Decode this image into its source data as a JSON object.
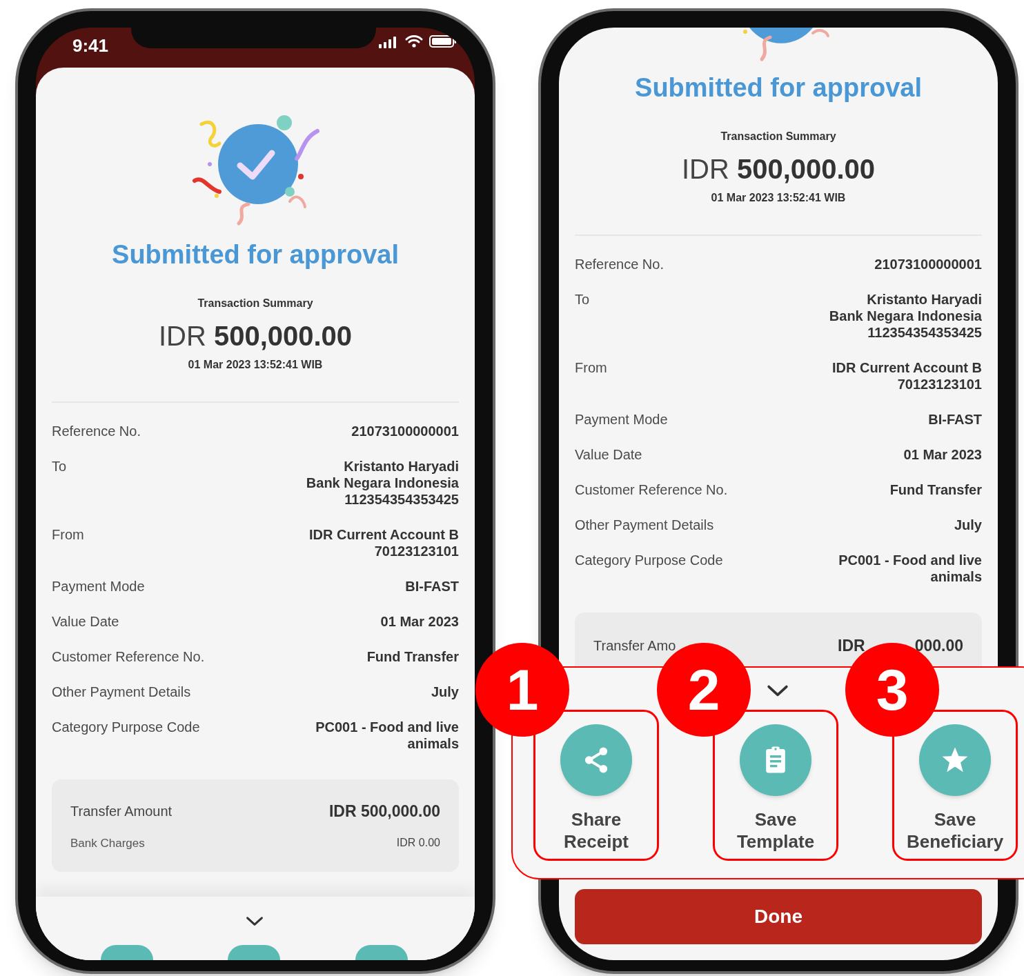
{
  "screens": [
    {
      "kind": "full",
      "status_bar": {
        "time": "9:41"
      },
      "title": "Submitted for approval",
      "summary_label": "Transaction Summary",
      "amount": {
        "currency": "IDR",
        "value": "500,000.00"
      },
      "datetime": "01 Mar 2023 13:52:41 WIB",
      "details": [
        {
          "label": "Reference No.",
          "value": [
            "21073100000001"
          ]
        },
        {
          "label": "To",
          "value": [
            "Kristanto Haryadi",
            "Bank Negara Indonesia",
            "112354354353425"
          ]
        },
        {
          "label": "From",
          "value": [
            "IDR Current Account B",
            "70123123101"
          ]
        },
        {
          "label": "Payment Mode",
          "value": [
            "BI-FAST"
          ]
        },
        {
          "label": "Value Date",
          "value": [
            "01 Mar 2023"
          ]
        },
        {
          "label": "Customer Reference No.",
          "value": [
            "Fund Transfer"
          ]
        },
        {
          "label": "Other Payment Details",
          "value": [
            "July"
          ]
        },
        {
          "label": "Category Purpose Code",
          "value": "PC001 - Food and live animals"
        }
      ],
      "totals": [
        {
          "label": "Transfer Amount",
          "value": [
            "IDR 500,000.00"
          ]
        },
        {
          "label": "Bank Charges",
          "value": [
            "IDR 0.00"
          ]
        }
      ]
    },
    {
      "kind": "scrolled",
      "title": "Submitted for approval",
      "summary_label": "Transaction Summary",
      "amount": {
        "currency": "IDR",
        "value": "500,000.00"
      },
      "datetime": "01 Mar 2023 13:52:41 WIB",
      "details": [
        {
          "label": "Reference No.",
          "value": [
            "21073100000001"
          ]
        },
        {
          "label": "To",
          "value": [
            "Kristanto Haryadi",
            "Bank Negara Indonesia",
            "112354354353425"
          ]
        },
        {
          "label": "From",
          "value": [
            "IDR Current Account B",
            "70123123101"
          ]
        },
        {
          "label": "Payment Mode",
          "value": [
            "BI-FAST"
          ]
        },
        {
          "label": "Value Date",
          "value": [
            "01 Mar 2023"
          ]
        },
        {
          "label": "Customer Reference No.",
          "value": [
            "Fund Transfer"
          ]
        },
        {
          "label": "Other Payment Details",
          "value": [
            "July"
          ]
        },
        {
          "label": "Category Purpose Code",
          "value": "PC001 - Food and live animals"
        }
      ],
      "totals": [
        {
          "label": "Transfer Amo",
          "value": [
            "IDR",
            "000.00"
          ]
        }
      ],
      "done_button": "Done"
    }
  ],
  "callouts": [
    {
      "number": "1",
      "label": "Share Receipt"
    },
    {
      "number": "2",
      "label": "Save Template"
    },
    {
      "number": "3",
      "label": "Save Beneficiary"
    }
  ]
}
